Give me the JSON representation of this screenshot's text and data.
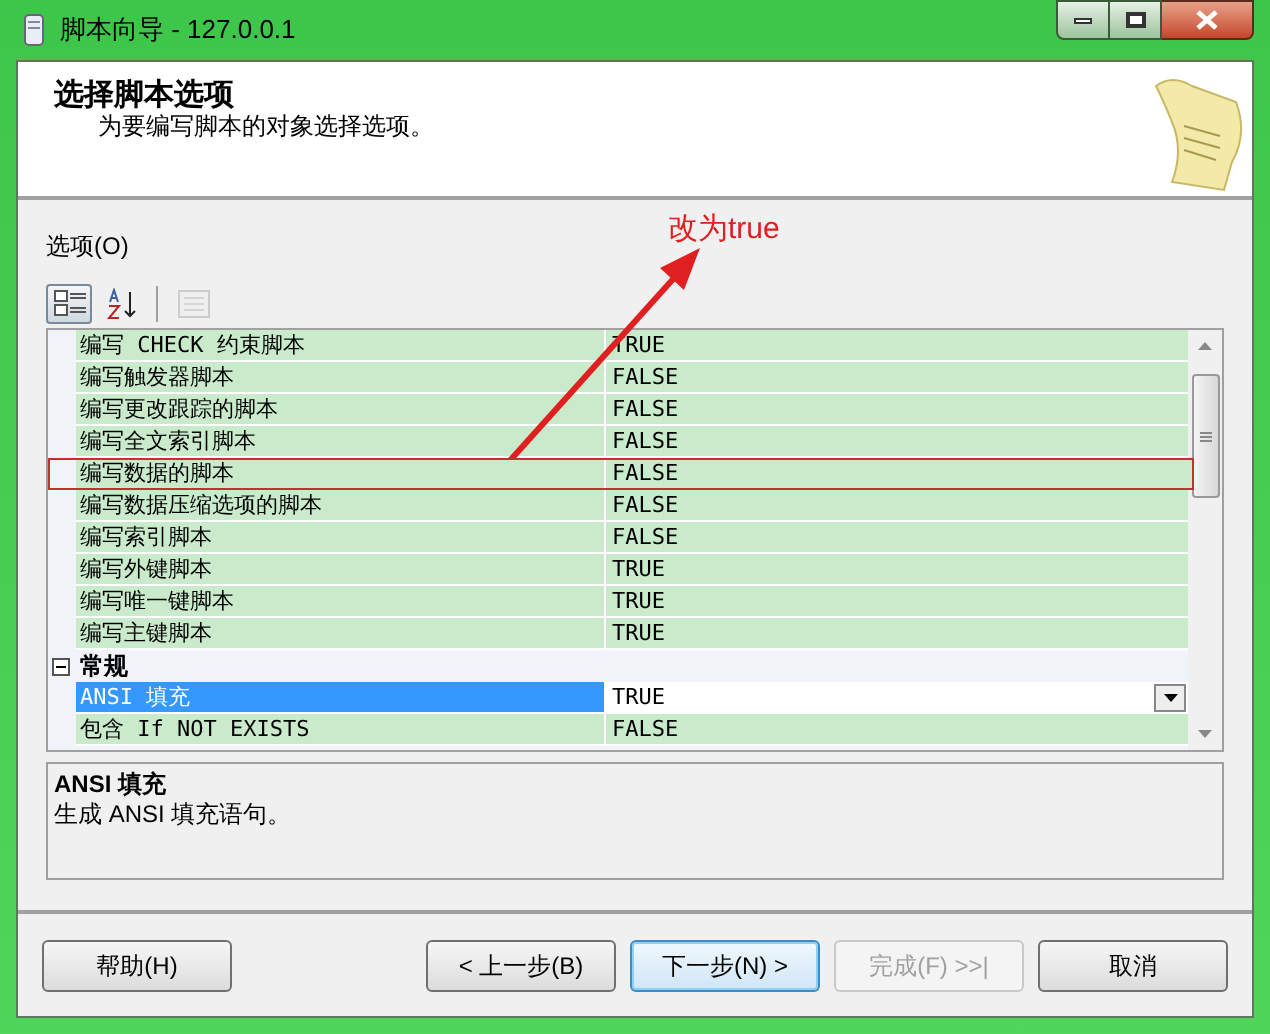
{
  "window": {
    "title": "脚本向导 - 127.0.0.1"
  },
  "header": {
    "title": "选择脚本选项",
    "subtitle": "为要编写脚本的对象选择选项。"
  },
  "annotation": {
    "text": "改为true"
  },
  "options_label": "选项(O)",
  "toolbar": [
    {
      "kind": "categorized",
      "selected": true,
      "disabled": false
    },
    {
      "kind": "alphabetical",
      "selected": false,
      "disabled": false
    },
    {
      "kind": "pages",
      "selected": false,
      "disabled": true
    }
  ],
  "rows": [
    {
      "kind": "property",
      "name": "编写 CHECK 约束脚本",
      "value": "TRUE",
      "selected": false,
      "highlighted": false
    },
    {
      "kind": "property",
      "name": "编写触发器脚本",
      "value": "FALSE",
      "selected": false,
      "highlighted": false
    },
    {
      "kind": "property",
      "name": "编写更改跟踪的脚本",
      "value": "FALSE",
      "selected": false,
      "highlighted": false
    },
    {
      "kind": "property",
      "name": "编写全文索引脚本",
      "value": "FALSE",
      "selected": false,
      "highlighted": false
    },
    {
      "kind": "property",
      "name": "编写数据的脚本",
      "value": "FALSE",
      "selected": false,
      "highlighted": true
    },
    {
      "kind": "property",
      "name": "编写数据压缩选项的脚本",
      "value": "FALSE",
      "selected": false,
      "highlighted": false
    },
    {
      "kind": "property",
      "name": "编写索引脚本",
      "value": "FALSE",
      "selected": false,
      "highlighted": false
    },
    {
      "kind": "property",
      "name": "编写外键脚本",
      "value": "TRUE",
      "selected": false,
      "highlighted": false
    },
    {
      "kind": "property",
      "name": "编写唯一键脚本",
      "value": "TRUE",
      "selected": false,
      "highlighted": false
    },
    {
      "kind": "property",
      "name": "编写主键脚本",
      "value": "TRUE",
      "selected": false,
      "highlighted": false
    },
    {
      "kind": "category",
      "name": "常规",
      "expanded": true
    },
    {
      "kind": "property",
      "name": "ANSI 填充",
      "value": "TRUE",
      "selected": true,
      "highlighted": false
    },
    {
      "kind": "property",
      "name": "包含 If NOT EXISTS",
      "value": "FALSE",
      "selected": false,
      "highlighted": false
    }
  ],
  "description": {
    "title": "ANSI 填充",
    "text": "生成 ANSI 填充语句。"
  },
  "buttons": [
    {
      "label": "帮助(H)",
      "disabled": false,
      "focused": false
    },
    {
      "label": "< 上一步(B)",
      "disabled": false,
      "focused": false
    },
    {
      "label": "下一步(N) >",
      "disabled": false,
      "focused": true
    },
    {
      "label": "完成(F) >>|",
      "disabled": true,
      "focused": false
    },
    {
      "label": "取消",
      "disabled": false,
      "focused": false
    }
  ]
}
